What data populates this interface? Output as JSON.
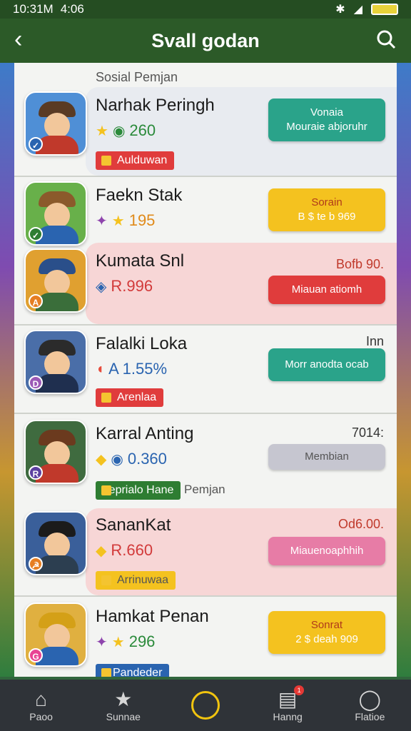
{
  "status": {
    "time": "10:31M",
    "time2": "4:06",
    "icons": [
      "bluetooth-icon",
      "signal-icon",
      "battery-icon"
    ],
    "battery": ""
  },
  "header": {
    "title": "Svall godan",
    "back_icon": "chevron-left-icon",
    "search_icon": "search-icon"
  },
  "section_label": "Sosial Pemjan",
  "rows": [
    {
      "name": "Narhak Peringh",
      "stat": "260",
      "tag": "Aulduwan",
      "button": [
        "Vonaia",
        "Mouraie abjoruhr"
      ],
      "corner": ""
    },
    {
      "name": "Faekn Stak",
      "stat": "195",
      "tag": "",
      "button": [
        "Sorain",
        "B $ te b 969"
      ],
      "corner": ""
    },
    {
      "name": "Kumata Snl",
      "stat": "R.996",
      "tag": "",
      "button": [
        "Miauan atiomh"
      ],
      "corner": "Bofb 90."
    },
    {
      "name": "Falalki Loka",
      "stat": "A 1.55%",
      "tag": "Arenlaa",
      "button": [
        "Morr anodta ocab"
      ],
      "corner": "Inn"
    },
    {
      "name": "Karral Anting",
      "stat": "0.360",
      "tag": "Seprialo Hane",
      "tag_suffix": "Pemjan",
      "button": [
        "Membian"
      ],
      "corner": "7014:"
    },
    {
      "name": "SananKat",
      "stat": "R.660",
      "tag": "Arrinuwaa",
      "button": [
        "Miauenoaphhih"
      ],
      "corner": "Od6.00."
    },
    {
      "name": "Hamkat Penan",
      "stat": "296",
      "tag": "N Pandeder",
      "button": [
        "Sonrat",
        "2 $ deah 909"
      ],
      "corner": ""
    }
  ],
  "nav": [
    {
      "label": "Paoo",
      "icon": "home-icon"
    },
    {
      "label": "Sunnae",
      "icon": "star-icon"
    },
    {
      "label": "",
      "icon": "chat-bubble-icon"
    },
    {
      "label": "Hanng",
      "icon": "news-icon",
      "badge": "1"
    },
    {
      "label": "Flatioe",
      "icon": "profile-icon"
    }
  ],
  "colors": {
    "header": "#2c5a28",
    "teal": "#2aa38a",
    "yellow": "#f4c21f",
    "red": "#e03c3c",
    "gray": "#c6c6d0",
    "pink": "#e77ca6",
    "tag_red": "#e03c3c",
    "tag_green": "#2e7d32",
    "tag_yellow": "#f4c21f",
    "tag_blue": "#2a64b0"
  }
}
